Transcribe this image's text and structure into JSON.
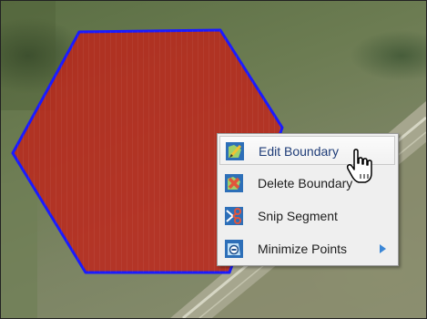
{
  "map": {
    "field_fill": "#c0231a",
    "boundary_color": "#1a1aff"
  },
  "context_menu": {
    "items": [
      {
        "label": "Edit Boundary",
        "icon": "edit-boundary-icon",
        "hovered": true
      },
      {
        "label": "Delete Boundary",
        "icon": "delete-boundary-icon"
      },
      {
        "label": "Snip Segment",
        "icon": "snip-segment-icon"
      },
      {
        "label": "Minimize Points",
        "icon": "minimize-points-icon",
        "has_submenu": true
      }
    ]
  },
  "cursor": {
    "icon": "hand-pointer-icon"
  }
}
